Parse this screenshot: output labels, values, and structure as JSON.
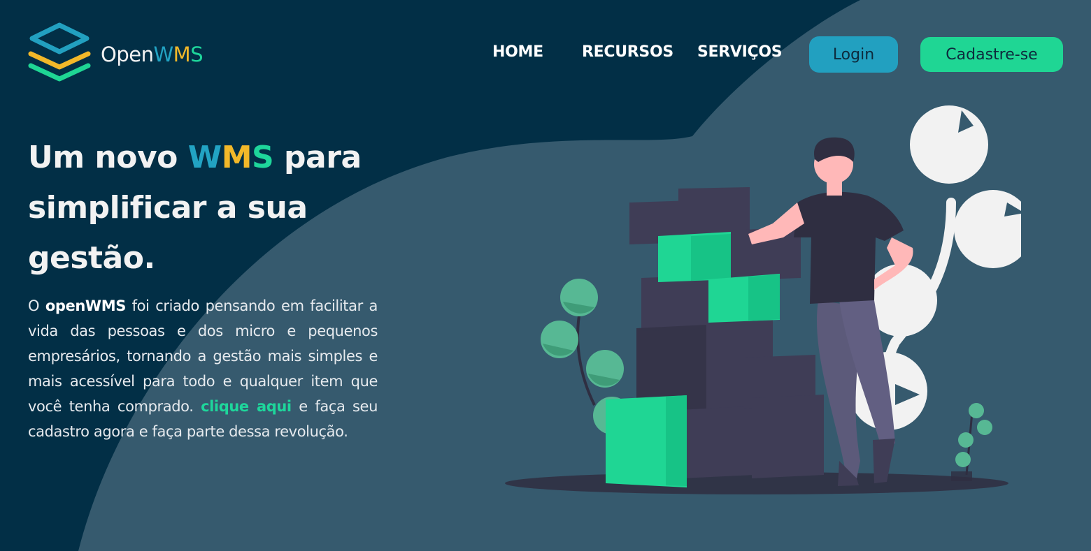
{
  "brand": {
    "name_prefix": "Open",
    "name_w": "W",
    "name_m": "M",
    "name_s": "S"
  },
  "nav": {
    "items": [
      {
        "label": "HOME"
      },
      {
        "label": "RECURSOS"
      },
      {
        "label": "SERVIÇOS"
      }
    ],
    "login_label": "Login",
    "signup_label": "Cadastre-se"
  },
  "hero": {
    "title_part1": "Um novo ",
    "title_w": "W",
    "title_m": "M",
    "title_s": "S",
    "title_part2": " para simplificar a sua gestão.",
    "text_intro": "O ",
    "text_brand": "openWMS",
    "text_body": " foi criado pensando em facilitar a vida das pessoas e dos micro e pequenos empresários, tornando a gestão mais simples e mais acessível para todo e qualquer item que você tenha comprado. ",
    "text_link": "clique aqui",
    "text_end": " e faça seu cadastro agora e faça parte dessa revolução."
  },
  "colors": {
    "background_dark": "#022f46",
    "background_shape": "#365a6e",
    "accent_blue": "#22a3c3",
    "accent_yellow": "#f2b829",
    "accent_green": "#1ed69b"
  },
  "icons": {
    "logo": "stacked-layers-icon"
  }
}
